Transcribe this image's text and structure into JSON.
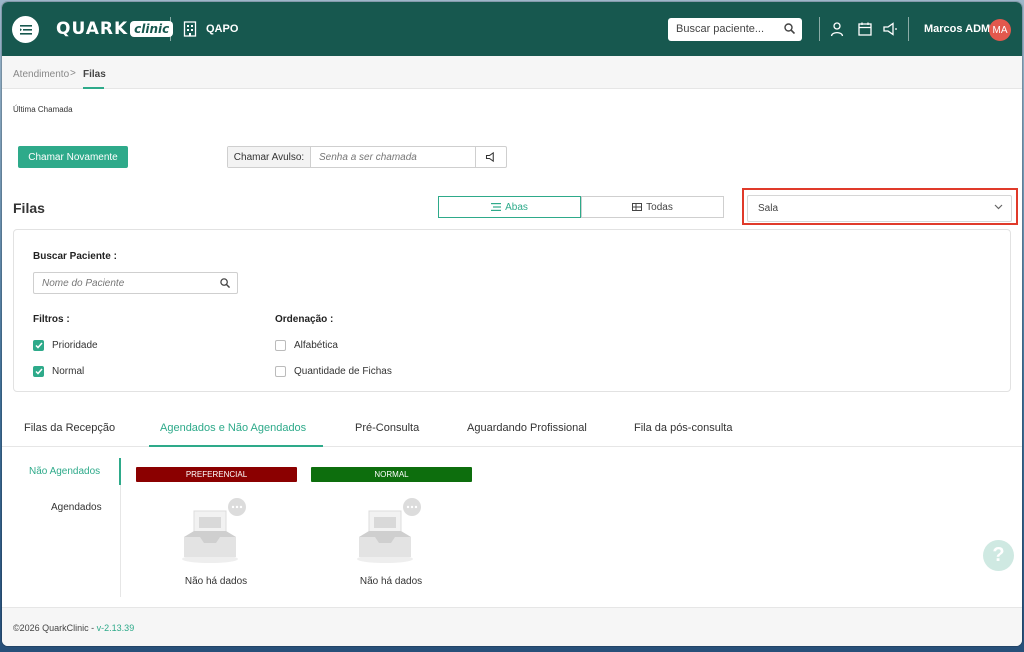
{
  "header": {
    "logo_text": "QUARK",
    "logo_pill": "clinic",
    "clinic_name": "QAPO",
    "search_placeholder": "Buscar paciente...",
    "user_name": "Marcos ADM",
    "avatar_initials": "MA"
  },
  "breadcrumb": {
    "parent": "Atendimento",
    "separator": ">",
    "current": "Filas"
  },
  "last_call": {
    "label": "Última Chamada"
  },
  "actions": {
    "call_again": "Chamar Novamente",
    "avulso_label": "Chamar Avulso:",
    "avulso_placeholder": "Senha a ser chamada"
  },
  "filas": {
    "title": "Filas",
    "toggle_abas": "Abas",
    "toggle_todas": "Todas",
    "sala_select": "Sala"
  },
  "filters": {
    "search_label": "Buscar Paciente :",
    "search_placeholder": "Nome do Paciente",
    "filtros_label": "Filtros :",
    "filtros": [
      {
        "label": "Prioridade",
        "checked": true
      },
      {
        "label": "Normal",
        "checked": true
      }
    ],
    "ordenacao_label": "Ordenação :",
    "ordenacao": [
      {
        "label": "Alfabética",
        "checked": false
      },
      {
        "label": "Quantidade de Fichas",
        "checked": false
      }
    ]
  },
  "tabs": [
    "Filas da Recepção",
    "Agendados e Não Agendados",
    "Pré-Consulta",
    "Aguardando Profissional",
    "Fila da pós-consulta"
  ],
  "active_tab": "Agendados e Não Agendados",
  "side_menu": [
    "Não Agendados",
    "Agendados"
  ],
  "queues": [
    {
      "name": "PREFERENCIAL",
      "color": "#8b0000",
      "empty_text": "Não há dados"
    },
    {
      "name": "NORMAL",
      "color": "#0d6e0d",
      "empty_text": "Não há dados"
    }
  ],
  "footer": {
    "copyright": "©2026 QuarkClinic - ",
    "version": "v-2.13.39"
  },
  "colors": {
    "brand": "#17584f",
    "accent": "#2eaa8a",
    "highlight": "#e03a2a"
  },
  "help_symbol": "?"
}
